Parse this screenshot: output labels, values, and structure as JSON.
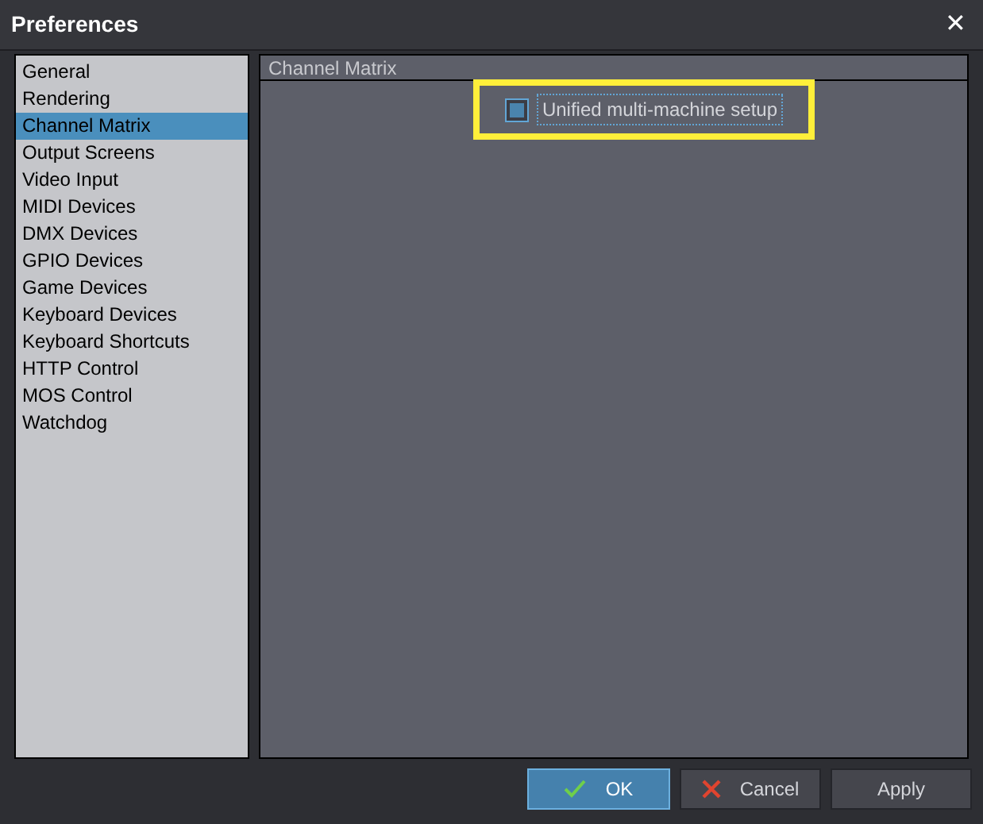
{
  "window": {
    "title": "Preferences",
    "close": "✕"
  },
  "sidebar": {
    "items": [
      {
        "label": "General",
        "selected": false
      },
      {
        "label": "Rendering",
        "selected": false
      },
      {
        "label": "Channel Matrix",
        "selected": true
      },
      {
        "label": "Output Screens",
        "selected": false
      },
      {
        "label": "Video Input",
        "selected": false
      },
      {
        "label": "MIDI Devices",
        "selected": false
      },
      {
        "label": "DMX Devices",
        "selected": false
      },
      {
        "label": "GPIO Devices",
        "selected": false
      },
      {
        "label": "Game Devices",
        "selected": false
      },
      {
        "label": "Keyboard Devices",
        "selected": false
      },
      {
        "label": "Keyboard Shortcuts",
        "selected": false
      },
      {
        "label": "HTTP Control",
        "selected": false
      },
      {
        "label": "MOS Control",
        "selected": false
      },
      {
        "label": "Watchdog",
        "selected": false
      }
    ]
  },
  "panel": {
    "title": "Channel Matrix",
    "checkbox": {
      "label": "Unified multi-machine setup",
      "checked": true,
      "highlighted": true
    }
  },
  "buttons": [
    {
      "label": "OK",
      "kind": "ok"
    },
    {
      "label": "Cancel",
      "kind": "cancel"
    },
    {
      "label": "Apply",
      "kind": "plain"
    }
  ]
}
